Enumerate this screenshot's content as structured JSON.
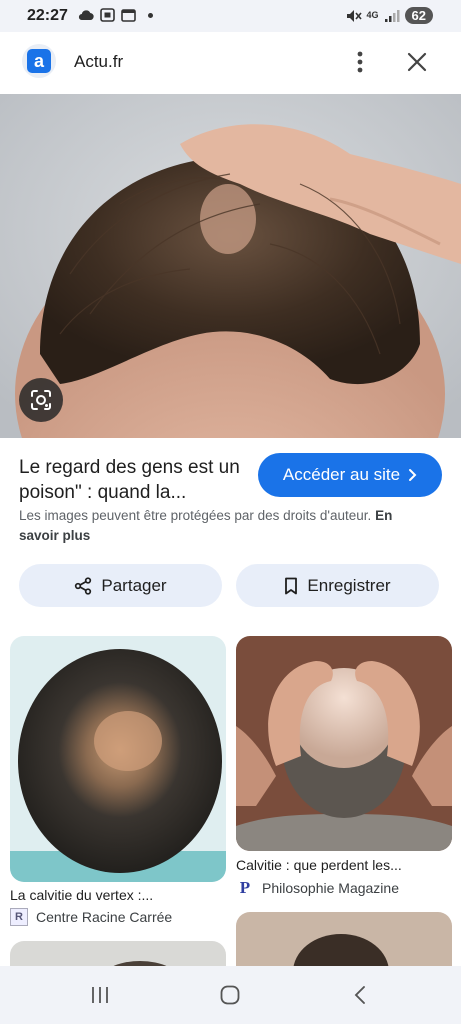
{
  "status_bar": {
    "time": "22:27",
    "network": "4G",
    "battery": "62"
  },
  "header": {
    "site_icon_letter": "a",
    "site_name": "Actu.fr"
  },
  "detail": {
    "title": "Le regard des gens est un poison\" : quand la...",
    "visit_button": "Accéder au site",
    "copyright_text": "Les images peuvent être protégées par des droits d'auteur.",
    "learn_more": "En savoir plus",
    "share_label": "Partager",
    "save_label": "Enregistrer"
  },
  "results": [
    {
      "caption": "La calvitie du vertex :...",
      "source": "Centre Racine Carrée",
      "source_icon": "R"
    },
    {
      "caption": "Calvitie : que perdent les...",
      "source": "Philosophie Magazine",
      "source_icon": "P"
    }
  ],
  "icons": {
    "accent": "#1a73e8"
  }
}
